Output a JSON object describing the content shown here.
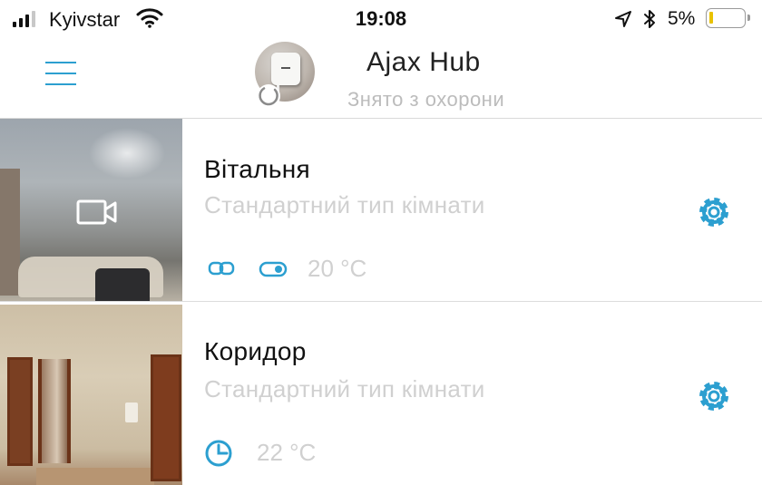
{
  "status_bar": {
    "carrier": "Kyivstar",
    "time": "19:08",
    "battery_percent": "5%",
    "signal_bars_filled": 3,
    "signal_bars_total": 4,
    "icons": [
      "signal-icon",
      "wifi-icon",
      "location-arrow-icon",
      "bluetooth-icon",
      "battery-icon"
    ]
  },
  "header": {
    "hub_name": "Ajax Hub",
    "hub_status": "Знято з охорони",
    "icons": [
      "menu-icon",
      "hub-avatar",
      "loading-spinner-icon"
    ]
  },
  "rooms": [
    {
      "name": "Вітальня",
      "type": "Стандартний тип кімнати",
      "temperature": "20 °C",
      "indicators": [
        "link-icon",
        "toggle-icon"
      ],
      "thumbnail_overlay": "video-camera-icon",
      "settings_icon": "gear-icon"
    },
    {
      "name": "Коридор",
      "type": "Стандартний тип кімнати",
      "temperature": "22 °C",
      "indicators": [
        "clock-icon"
      ],
      "settings_icon": "gear-icon"
    }
  ],
  "colors": {
    "accent": "#2c9fd0",
    "muted_text": "#d0d0d0",
    "battery_low": "#e9c200"
  }
}
